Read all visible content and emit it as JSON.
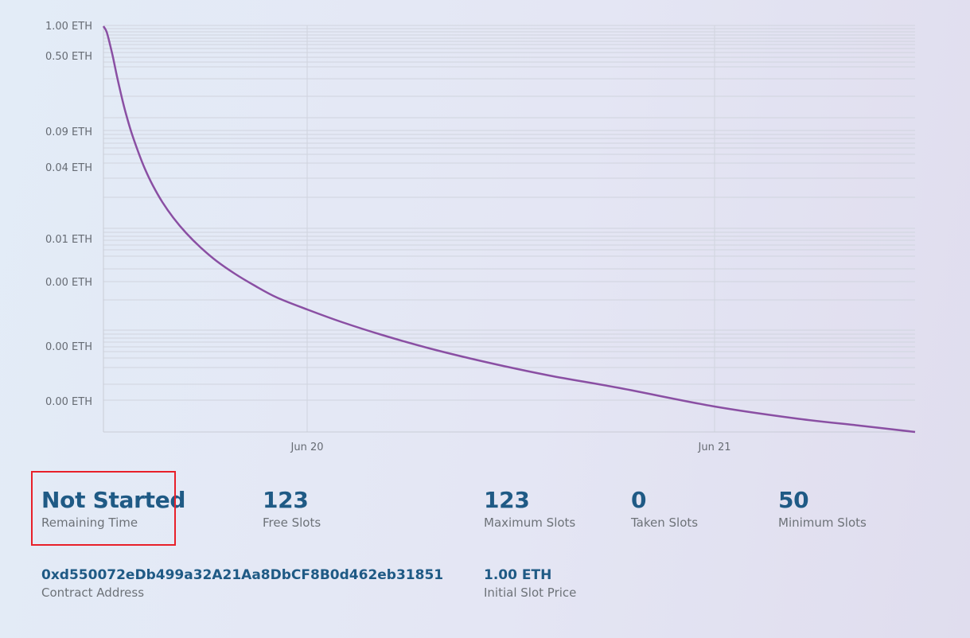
{
  "chart_data": {
    "type": "line",
    "y_scale": "log",
    "y_tick_labels": [
      "1.00 ETH",
      "0.50 ETH",
      "0.09 ETH",
      "0.04 ETH",
      "0.01 ETH",
      "0.00 ETH",
      "0.00 ETH",
      "0.00 ETH"
    ],
    "x_tick_labels": [
      "Jun 20",
      "Jun 21"
    ],
    "series_color": "#8a4fa3",
    "grid": true
  },
  "stats": {
    "remaining_time": {
      "value": "Not Started",
      "label": "Remaining Time"
    },
    "free_slots": {
      "value": "123",
      "label": "Free Slots"
    },
    "maximum_slots": {
      "value": "123",
      "label": "Maximum Slots"
    },
    "taken_slots": {
      "value": "0",
      "label": "Taken Slots"
    },
    "minimum_slots": {
      "value": "50",
      "label": "Minimum Slots"
    },
    "contract_address": {
      "value": "0xd550072eDb499a32A21Aa8DbCF8B0d462eb31851",
      "label": "Contract Address"
    },
    "initial_slot_price": {
      "value": "1.00 ETH",
      "label": "Initial Slot Price"
    }
  },
  "colors": {
    "value_text": "#1f5a85",
    "label_text": "#6d7278",
    "highlight": "#e8202a"
  }
}
